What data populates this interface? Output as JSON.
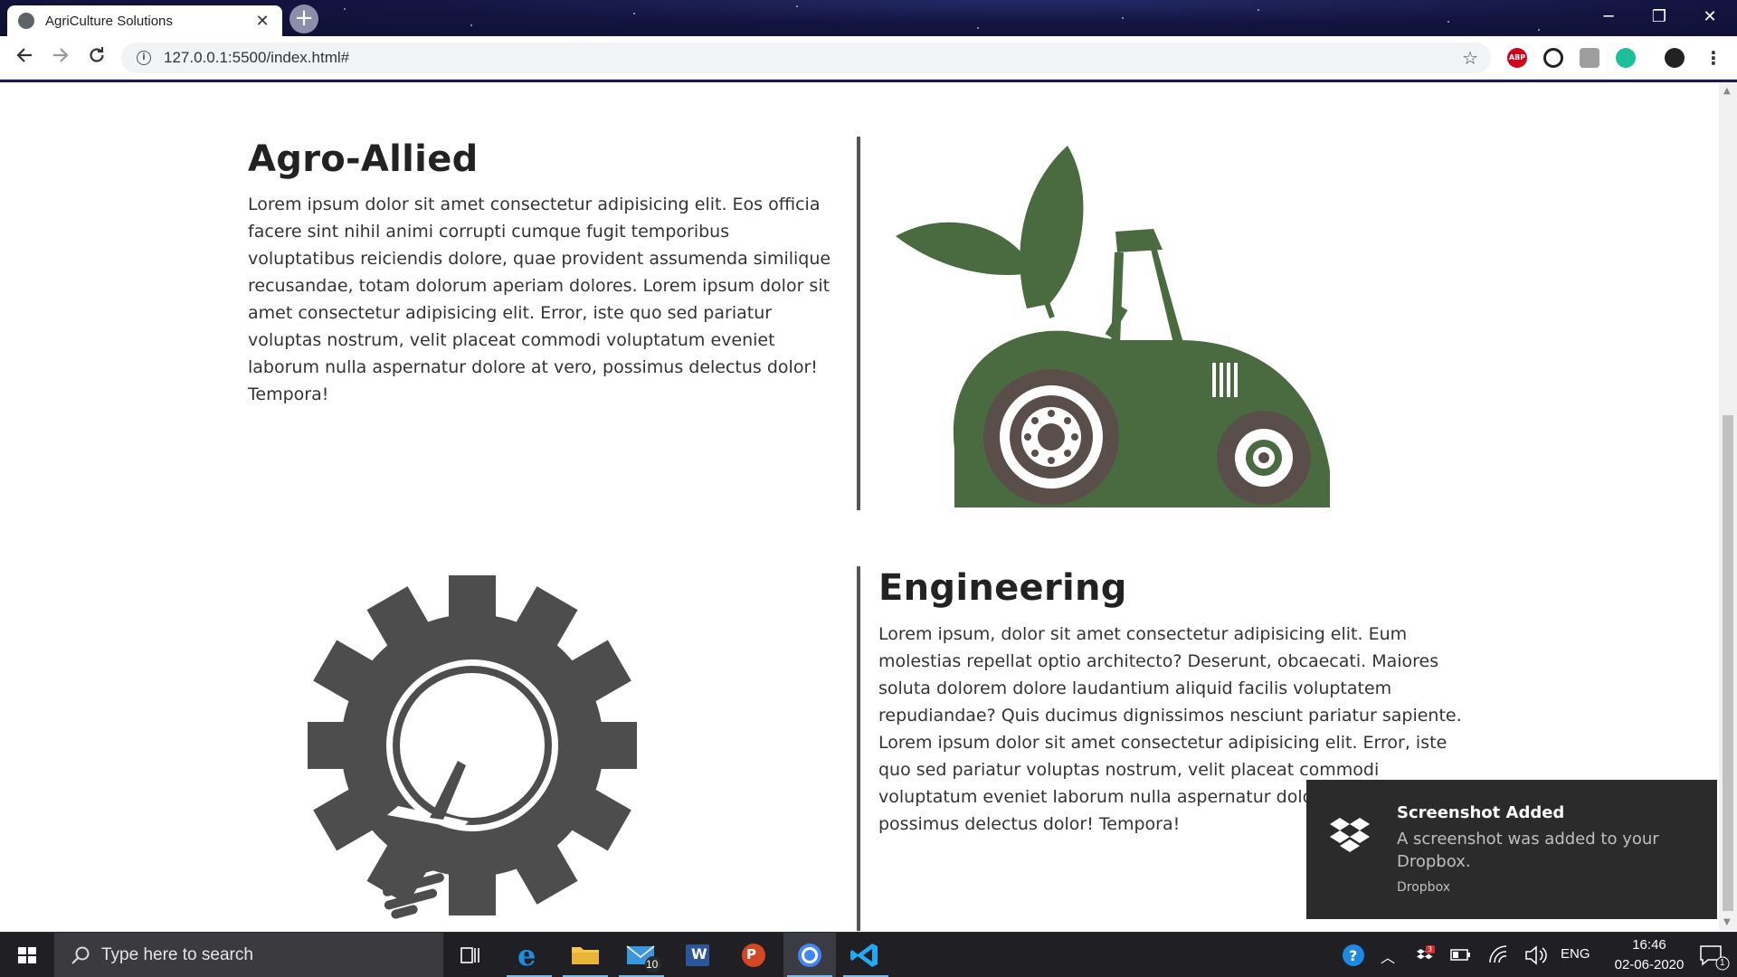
{
  "browser": {
    "tab_title": "AgriCulture Solutions",
    "tab_close": "✕",
    "new_tab": "+",
    "url": "127.0.0.1:5500/index.html#",
    "window": {
      "minimize": "─",
      "restore": "❐",
      "close": "✕"
    },
    "extensions": [
      "ABP"
    ]
  },
  "sections": [
    {
      "heading": "Agro-Allied",
      "text": "Lorem ipsum dolor sit amet consectetur adipisicing elit. Eos officia facere sint nihil animi corrupti cumque fugit temporibus voluptatibus reiciendis dolore, quae provident assumenda similique recusandae, totam dolorum aperiam dolores. Lorem ipsum dolor sit amet consectetur adipisicing elit. Error, iste quo sed pariatur voluptas nostrum, velit placeat commodi voluptatum eveniet laborum nulla aspernatur dolore at vero, possimus delectus dolor! Tempora!",
      "image": "tractor-leaf-icon",
      "image_color": "#4a6b3f",
      "wheel_color": "#5a4e4a"
    },
    {
      "heading": "Engineering",
      "text": "Lorem ipsum, dolor sit amet consectetur adipisicing elit. Eum molestias repellat optio architecto? Deserunt, obcaecati. Maiores soluta dolorem dolore laudantium aliquid facilis voluptatem repudiandae? Quis ducimus dignissimos nesciunt pariatur sapiente. Lorem ipsum dolor sit amet consectetur adipisicing elit. Error, iste quo sed pariatur voluptas nostrum, velit placeat commodi voluptatum eveniet laborum nulla aspernatur dolore at vero, possimus delectus dolor! Tempora!",
      "image": "gear-bulb-icon",
      "image_color": "#4d4d4d"
    }
  ],
  "toast": {
    "title": "Screenshot Added",
    "body": "A screenshot was added to your Dropbox.",
    "source": "Dropbox"
  },
  "taskbar": {
    "search_placeholder": "Type here to search",
    "mail_badge": "10",
    "word_label": "W",
    "ppt_label": "P",
    "language": "ENG",
    "time": "16:46",
    "date": "02-06-2020",
    "notification_count": "1",
    "dropbox_badge": "3"
  },
  "colors": {
    "titlebar": "#131540",
    "accent": "#76b9ed",
    "divider": "#555555"
  }
}
